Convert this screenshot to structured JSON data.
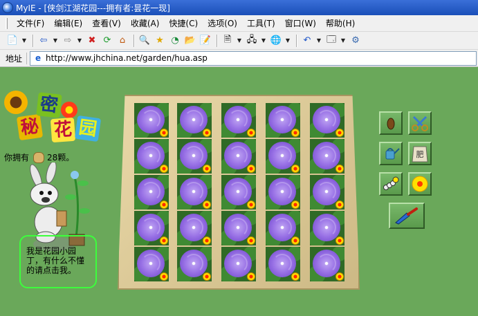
{
  "window": {
    "title": "MyIE - [侠剑江湖花园---拥有者:昙花一现]"
  },
  "menu": {
    "items": [
      "文件(F)",
      "编辑(E)",
      "查看(V)",
      "收藏(A)",
      "快捷(C)",
      "选项(O)",
      "工具(T)",
      "窗口(W)",
      "帮助(H)"
    ]
  },
  "address": {
    "label": "地址",
    "url": "http://www.jhchina.net/garden/hua.asp"
  },
  "page": {
    "logo_chars": [
      "秘",
      "密",
      "花",
      "园"
    ],
    "seeds_prefix": "你拥有",
    "seeds_count": "28颗。",
    "gardener_text": "我是花园小园丁，有什么不懂的请点击我。",
    "tool_fertilizer_label": "肥"
  },
  "colors": {
    "page_bg": "#6aa85a",
    "speech_border": "#3cff3c",
    "flower": "#9a73e6",
    "board": "#e4d3a0"
  },
  "icons": {
    "tools": [
      "seed-icon",
      "scissors-icon",
      "watering-can-icon",
      "fertilizer-bag-icon",
      "caterpillar-icon",
      "sunflower-icon",
      "trowel-icon"
    ]
  }
}
